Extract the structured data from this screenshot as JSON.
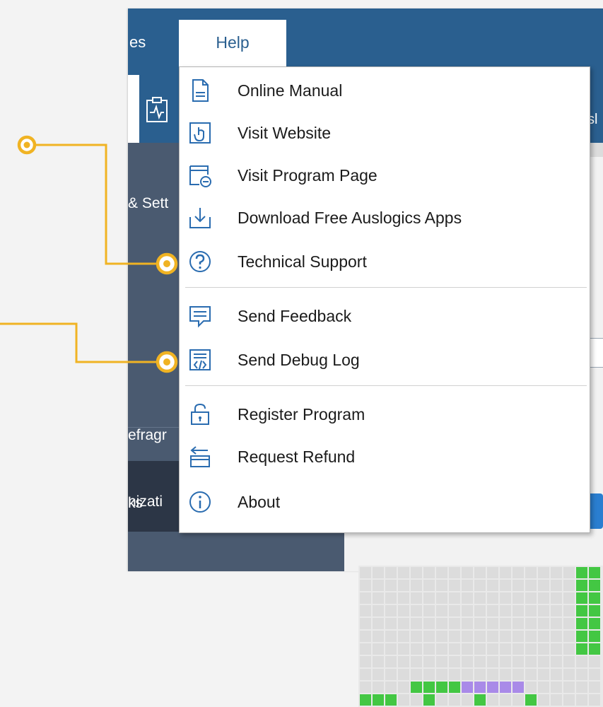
{
  "menubar": {
    "left_fragment": "es",
    "help_label": "Help"
  },
  "toolbar": {
    "right_fragment": "sl"
  },
  "sidebar": {
    "settings_fragment": "& Sett",
    "tasks_fragment": "ks",
    "defrag_fragment": "efragr",
    "optimization_fragment": "nizati"
  },
  "help_menu": {
    "groups": [
      [
        {
          "label": "Online Manual",
          "icon": "document-icon"
        },
        {
          "label": "Visit Website",
          "icon": "hand-pointer-icon"
        },
        {
          "label": "Visit Program Page",
          "icon": "program-page-icon"
        },
        {
          "label": "Download Free Auslogics Apps",
          "icon": "download-icon"
        },
        {
          "label": "Technical Support",
          "icon": "question-circle-icon"
        }
      ],
      [
        {
          "label": "Send Feedback",
          "icon": "feedback-icon"
        },
        {
          "label": "Send Debug Log",
          "icon": "debug-log-icon"
        }
      ],
      [
        {
          "label": "Register Program",
          "icon": "lock-icon"
        },
        {
          "label": "Request Refund",
          "icon": "refund-icon"
        },
        {
          "label": "About",
          "icon": "info-icon"
        }
      ]
    ]
  },
  "colors": {
    "menubar": "#2a5f8f",
    "sidebar": "#4a5a70",
    "callout": "#f0b323",
    "icon_blue": "#2a6cb0",
    "map_green": "#43c743",
    "map_purple": "#a98ae8"
  }
}
